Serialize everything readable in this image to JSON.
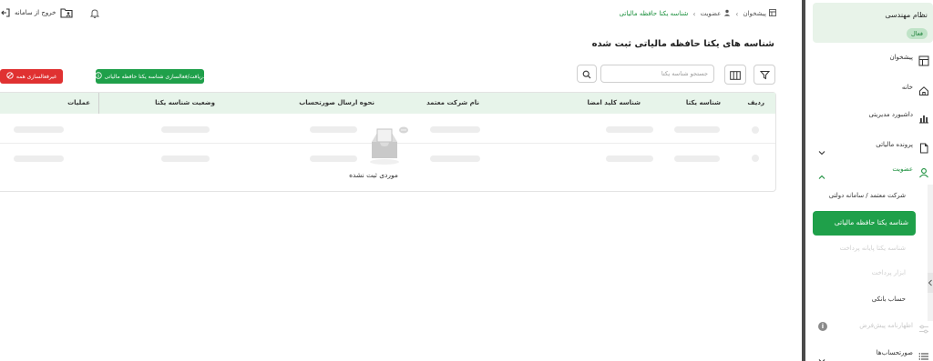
{
  "topbar": {
    "exit_label": "خروج از سامانه",
    "breadcrumb": [
      "پیشخوان",
      "عضویت",
      "شناسه یکتا حافظه مالیاتی"
    ]
  },
  "page": {
    "title": "شناسه های یکتا حافظه مالیاتی ثبت شده"
  },
  "toolbar": {
    "search_placeholder": "جستجو شناسه یکتا",
    "fetch_button": "دریافت/فعالسازی شناسه یکتا حافظه مالیاتی",
    "deactivate_button": "غیرفعالسازی همه"
  },
  "table": {
    "columns": [
      "ردیف",
      "شناسه یکتا",
      "شناسه کلید امضا",
      "نام شرکت معتمد",
      "نحوه ارسال صورتحساب",
      "وضعیت شناسه یکتا",
      "عملیات"
    ],
    "empty_text": "موردی ثبت نشده"
  },
  "sidebar": {
    "org_name": "نظام مهندسی",
    "org_status": "فعال",
    "items": [
      {
        "label": "پیشخوان",
        "icon": "dashboard-icon"
      },
      {
        "label": "خانه",
        "icon": "home-icon"
      },
      {
        "label": "داشبورد مدیریتی",
        "icon": "chart-icon"
      },
      {
        "label": "پرونده مالیاتی",
        "icon": "file-icon"
      },
      {
        "label": "عضویت",
        "icon": "user-icon"
      },
      {
        "label": "اظهارنامه پیش‌فرض",
        "icon": "sliders-icon"
      },
      {
        "label": "صورتحساب‌ها",
        "icon": "list-icon"
      }
    ],
    "membership_sub": [
      "شرکت معتمد / سامانه دولتی",
      "شناسه یکتا حافظه مالیاتی",
      "شناسه یکتا پایانه پرداخت",
      "ابزار پرداخت",
      "حساب بانکی"
    ]
  },
  "colors": {
    "primary_green": "#1fa04a",
    "danger_red": "#e03131",
    "header_bg": "#e7f4ea"
  }
}
